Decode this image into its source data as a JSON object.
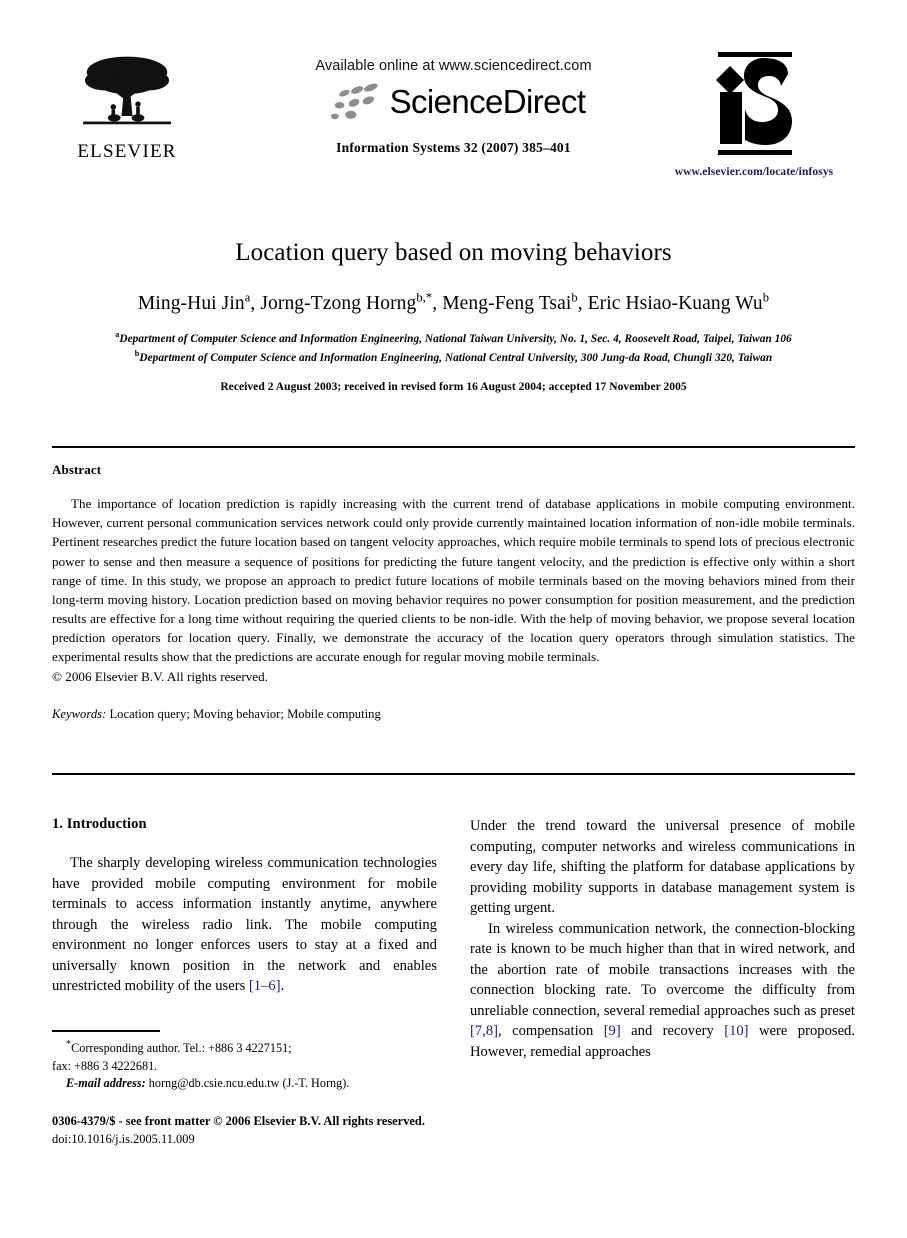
{
  "masthead": {
    "publisher_name": "ELSEVIER",
    "publisher_logo_icon": "elsevier-tree-icon",
    "available_online": "Available online at www.sciencedirect.com",
    "sciencedirect_wordmark": "ScienceDirect",
    "sciencedirect_logo_icon": "sciencedirect-dots-icon",
    "journal_reference": "Information Systems 32 (2007) 385–401",
    "journal_logo_icon": "information-systems-is-logo-icon",
    "journal_url": "www.elsevier.com/locate/infosys",
    "url_color": "#1b1b63"
  },
  "title_block": {
    "title": "Location query based on moving behaviors",
    "authors": [
      {
        "name": "Ming-Hui Jin",
        "sup": "a",
        "sep": ", "
      },
      {
        "name": "Jorng-Tzong Horng",
        "sup": "b,*",
        "sep": ", "
      },
      {
        "name": "Meng-Feng Tsai",
        "sup": "b",
        "sep": ", "
      },
      {
        "name": "Eric Hsiao-Kuang Wu",
        "sup": "b",
        "sep": ""
      }
    ],
    "affiliation_a_sup": "a",
    "affiliation_a": "Department of Computer Science and Information Engineering, National Taiwan University, No. 1, Sec. 4, Roosevelt Road, Taipei, Taiwan 106",
    "affiliation_b_sup": "b",
    "affiliation_b": "Department of Computer Science and Information Engineering, National Central University, 300 Jung-da Road, Chungli 320, Taiwan",
    "history": "Received 2 August 2003; received in revised form 16 August 2004; accepted 17 November 2005"
  },
  "abstract": {
    "heading": "Abstract",
    "text": "The importance of location prediction is rapidly increasing with the current trend of database applications in mobile computing environment. However, current personal communication services network could only provide currently maintained location information of non-idle mobile terminals. Pertinent researches predict the future location based on tangent velocity approaches, which require mobile terminals to spend lots of precious electronic power to sense and then measure a sequence of positions for predicting the future tangent velocity, and the prediction is effective only within a short range of time. In this study, we propose an approach to predict future locations of mobile terminals based on the moving behaviors mined from their long-term moving history. Location prediction based on moving behavior requires no power consumption for position measurement, and the prediction results are effective for a long time without requiring the queried clients to be non-idle. With the help of moving behavior, we propose several location prediction operators for location query. Finally, we demonstrate the accuracy of the location query operators through simulation statistics. The experimental results show that the predictions are accurate enough for regular moving mobile terminals.",
    "copyright": "© 2006 Elsevier B.V. All rights reserved.",
    "keywords_label": "Keywords:",
    "keywords_value": "Location query; Moving behavior; Mobile computing"
  },
  "body": {
    "section_heading": "1.  Introduction",
    "left_paragraph_1_a": "The sharply developing wireless communication technologies have provided mobile computing environment for mobile terminals to access information instantly anytime, anywhere through the wireless radio link. The mobile computing environment no longer enforces users to stay at a fixed and universally known position in the network and enables unrestricted mobility of the users ",
    "left_paragraph_1_cite": "[1–6]",
    "left_paragraph_1_b": ".",
    "right_paragraph_1": "Under the trend toward the universal presence of mobile computing, computer networks and wireless communications in every day life, shifting the platform for database applications by providing mobility supports in database management system is getting urgent.",
    "right_paragraph_2_a": "In wireless communication network, the connection-blocking rate is known to be much higher than that in wired network, and the abortion rate of mobile transactions increases with the connection blocking rate. To overcome the difficulty from unreliable connection, several remedial approaches such as preset ",
    "right_paragraph_2_cite1": "[7,8]",
    "right_paragraph_2_b": ", compensation ",
    "right_paragraph_2_cite2": "[9]",
    "right_paragraph_2_c": " and recovery ",
    "right_paragraph_2_cite3": "[10]",
    "right_paragraph_2_d": " were proposed. However, remedial approaches",
    "citation_color": "#1b1b8f"
  },
  "footnote": {
    "line1_sup": "*",
    "line1": "Corresponding author. Tel.: +886 3 4227151;",
    "line2": "fax: +886 3 4222681.",
    "email_label": "E-mail address:",
    "email_value": "horng@db.csie.ncu.edu.tw (J.-T. Horng)."
  },
  "imprint": {
    "line1": "0306-4379/$ - see front matter © 2006 Elsevier B.V. All rights reserved.",
    "line2": "doi:10.1016/j.is.2005.11.009"
  }
}
